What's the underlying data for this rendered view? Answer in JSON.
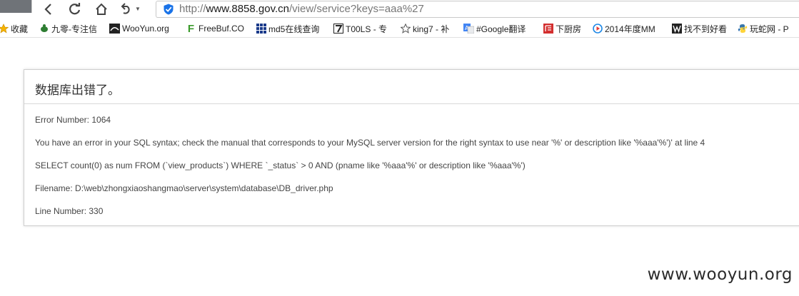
{
  "browser": {
    "url_prefix": "http://",
    "url_domain": "www.8858.gov.cn",
    "url_path": "/view/service?keys=aaa%27"
  },
  "bookmarks": [
    {
      "label": "收藏",
      "icon": "star-icon"
    },
    {
      "label": "九零-专注信",
      "icon": "turtle-icon"
    },
    {
      "label": "WooYun.org",
      "icon": "wooyun-icon"
    },
    {
      "label": "FreeBuf.CO",
      "icon": "freebuf-icon"
    },
    {
      "label": "md5在线查询",
      "icon": "grid-icon"
    },
    {
      "label": "T00LS - 专",
      "icon": "tools-icon"
    },
    {
      "label": "king7 - 补",
      "icon": "star-outline-icon"
    },
    {
      "label": "#Google翻译",
      "icon": "translate-icon"
    },
    {
      "label": "下厨房",
      "icon": "xiachufang-icon"
    },
    {
      "label": "2014年度MM",
      "icon": "play-circle-icon"
    },
    {
      "label": "找不到好看",
      "icon": "w-icon"
    },
    {
      "label": "玩蛇网 - P",
      "icon": "python-icon"
    }
  ],
  "error": {
    "title": "数据库出错了。",
    "error_number": "Error Number: 1064",
    "message": "You have an error in your SQL syntax; check the manual that corresponds to your MySQL server version for the right syntax to use near '%' or description like '%aaa'%')' at line 4",
    "query": "SELECT count(0) as num FROM (`view_products`) WHERE `_status` > 0 AND (pname like '%aaa'%' or description like '%aaa'%')",
    "filename": "Filename: D:\\web\\zhongxiaoshangmao\\server\\system\\database\\DB_driver.php",
    "line_number": "Line Number: 330"
  },
  "watermark": "www.wooyun.org",
  "colors": {
    "shield_blue": "#1a73e8",
    "panel_border": "#cfcfcf",
    "freebuf_green": "#3a9a2a",
    "xiachufang_red": "#d32f2f"
  }
}
